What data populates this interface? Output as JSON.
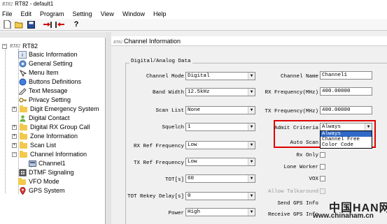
{
  "window": {
    "logo": "RT82",
    "title": "RT82 - default1"
  },
  "menu": [
    "File",
    "Edit",
    "Program",
    "Setting",
    "View",
    "Window",
    "Help"
  ],
  "toolbar": {
    "icons": [
      "new-icon",
      "open-icon",
      "save-icon",
      "read-icon",
      "write-icon",
      "help-icon"
    ]
  },
  "tree": {
    "root": "RT82",
    "items": [
      {
        "label": "Basic Information",
        "icon": "info-icon"
      },
      {
        "label": "General Setting",
        "icon": "gear-icon"
      },
      {
        "label": "Menu Item",
        "icon": "menu-icon"
      },
      {
        "label": "Buttons Definitions",
        "icon": "button-icon"
      },
      {
        "label": "Text Message",
        "icon": "message-icon"
      },
      {
        "label": "Privacy Setting",
        "icon": "key-icon"
      },
      {
        "label": "Digit Emergency System",
        "icon": "folder-icon"
      },
      {
        "label": "Digital Contact",
        "icon": "contact-icon"
      },
      {
        "label": "Digital RX Group Call",
        "icon": "folder-icon"
      },
      {
        "label": "Zone Information",
        "icon": "folder-icon"
      },
      {
        "label": "Scan List",
        "icon": "folder-icon"
      },
      {
        "label": "Channel Information",
        "icon": "folder-icon"
      },
      {
        "label": "Channel1",
        "icon": "channel-icon"
      },
      {
        "label": "DTMF Signaling",
        "icon": "dtmf-icon"
      },
      {
        "label": "VFO Mode",
        "icon": "folder-icon"
      },
      {
        "label": "GPS System",
        "icon": "gps-icon"
      }
    ]
  },
  "panel": {
    "title": "Channel Information",
    "group": "Digital/Analog Data",
    "left": {
      "channel_mode": {
        "label": "Channel Mode",
        "value": "Digital"
      },
      "band_width": {
        "label": "Band Width",
        "value": "12.5kHz"
      },
      "scan_list": {
        "label": "Scan List",
        "value": "None"
      },
      "squelch": {
        "label": "Squelch",
        "value": "1"
      },
      "rx_ref": {
        "label": "RX Ref Frequency",
        "value": "Low"
      },
      "tx_ref": {
        "label": "TX Ref Frequency",
        "value": "Low"
      },
      "tot": {
        "label": "TOT[s]",
        "value": "60"
      },
      "tot_rekey": {
        "label": "TOT Rekey Delay[s]",
        "value": "0"
      },
      "power": {
        "label": "Power",
        "value": "High"
      }
    },
    "right": {
      "channel_name": {
        "label": "Channel Name",
        "value": "Channel1"
      },
      "rx_freq": {
        "label": "RX Frequency(MHz)",
        "value": "400.00000"
      },
      "tx_freq": {
        "label": "TX Frequency(MHz)",
        "value": "400.00000"
      },
      "admit": {
        "label": "Admit Criteria",
        "value": "Always"
      },
      "auto_scan": {
        "label": "Auto Scan"
      },
      "rx_only": {
        "label": "Rx Only"
      },
      "lone_worker": {
        "label": "Lone Worker"
      },
      "vox": {
        "label": "VOX"
      },
      "allow_talkaround": {
        "label": "Allow Talkaround"
      },
      "send_gps": {
        "label": "Send GPS Info"
      },
      "receive_gps": {
        "label": "Receive GPS Info"
      }
    },
    "admit_options": [
      "Always",
      "Channel Free",
      "Color Code"
    ]
  },
  "watermark": {
    "main": "中国HAN网",
    "url": "www.chinaham.cn"
  },
  "colors": {
    "highlight": "#e00000",
    "selection": "#3169c6"
  }
}
